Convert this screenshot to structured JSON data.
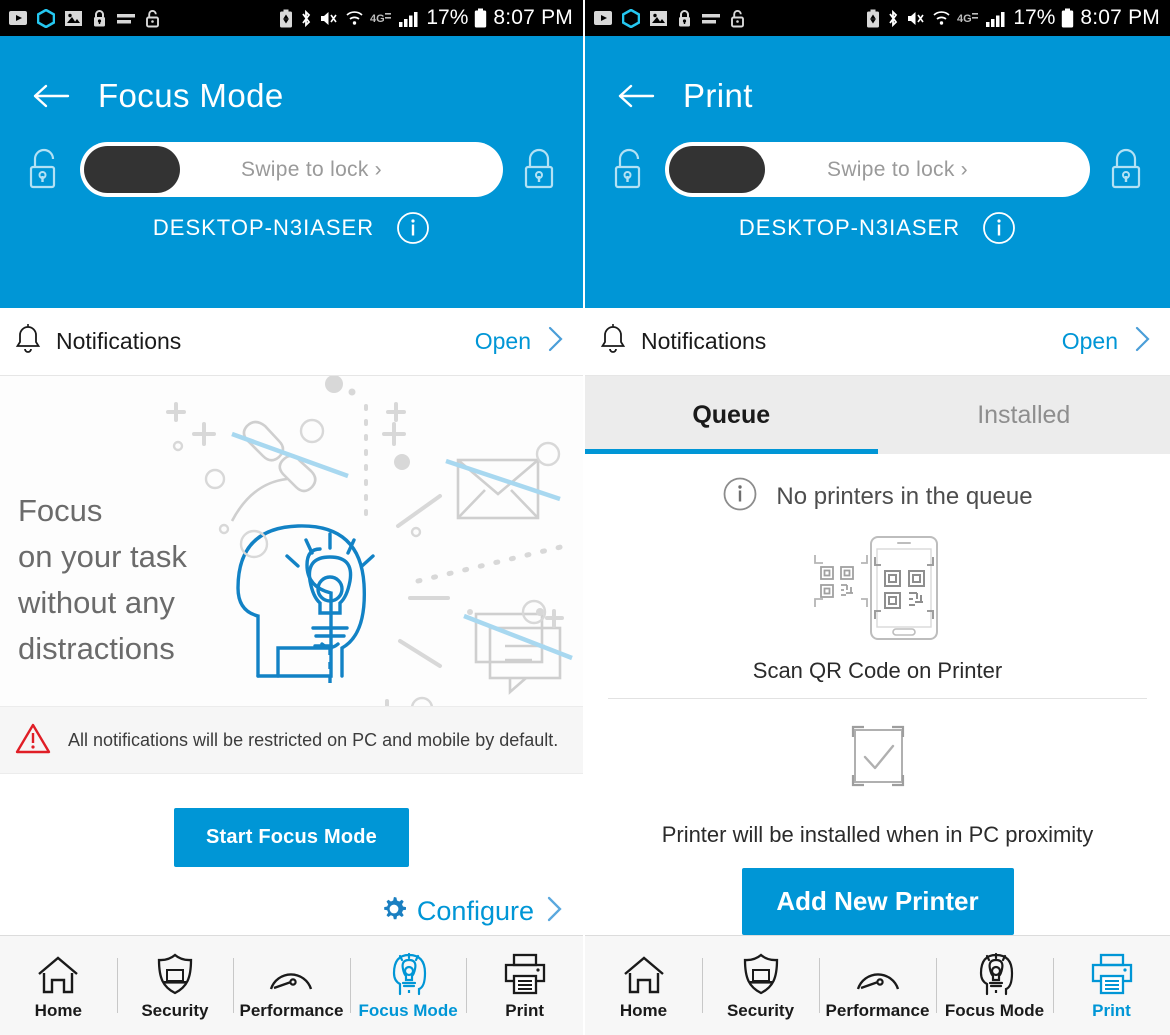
{
  "statusbar": {
    "left_icons": [
      "play-video-icon",
      "hexagon-icon",
      "image-icon",
      "lock-message-icon",
      "messages-icon",
      "unlocked-padlock-icon"
    ],
    "right_icons": [
      "battery-saver-icon",
      "bluetooth-icon",
      "mute-vibrate-icon",
      "wifi-icon",
      "4g-icon",
      "signal-bars-icon"
    ],
    "battery_percent": "17%",
    "time": "8:07 PM",
    "network": "4G"
  },
  "screens": [
    {
      "id": "focus-mode",
      "header": {
        "title": "Focus Mode",
        "back_icon": "back-arrow-icon",
        "left_lock_icon": "unlocked-padlock-icon",
        "right_lock_icon": "locked-padlock-icon",
        "swipe_label": "Swipe to lock",
        "swipe_chevron": "›",
        "device_name": "DESKTOP-N3IASER",
        "info_icon": "info-icon"
      },
      "notifications": {
        "bell_icon": "bell-icon",
        "label": "Notifications",
        "open_label": "Open",
        "chevron_icon": "chevron-right-icon"
      },
      "illustration": {
        "line1": "Focus",
        "line2": "on your task",
        "line3": "without any",
        "line4": "distractions",
        "icons": [
          "phone-handset-icon",
          "envelope-icon",
          "chat-bubbles-icon",
          "head-lightbulb-icon"
        ]
      },
      "warning": {
        "icon": "warning-triangle-icon",
        "color": "#e01e26",
        "text": "All notifications will be restricted on PC and mobile by default."
      },
      "start_button": "Start Focus Mode",
      "configure": {
        "icon": "gear-icon",
        "label": "Configure",
        "chevron_icon": "chevron-right-icon"
      }
    },
    {
      "id": "print",
      "header": {
        "title": "Print",
        "back_icon": "back-arrow-icon",
        "left_lock_icon": "unlocked-padlock-icon",
        "right_lock_icon": "locked-padlock-icon",
        "swipe_label": "Swipe to lock",
        "swipe_chevron": "›",
        "device_name": "DESKTOP-N3IASER",
        "info_icon": "info-icon"
      },
      "notifications": {
        "bell_icon": "bell-icon",
        "label": "Notifications",
        "open_label": "Open",
        "chevron_icon": "chevron-right-icon"
      },
      "tabs": [
        {
          "label": "Queue",
          "active": true
        },
        {
          "label": "Installed",
          "active": false
        }
      ],
      "empty_state": {
        "icon": "info-icon",
        "text": "No printers in the queue"
      },
      "scan": {
        "icon": "qr-scan-phone-icon",
        "label": "Scan QR Code on Printer"
      },
      "proximity": {
        "icon": "checkmark-scan-icon",
        "label": "Printer will be installed when in PC proximity"
      },
      "add_button": "Add New Printer"
    }
  ],
  "bottomnav": {
    "items": [
      {
        "label": "Home",
        "icon": "home-icon"
      },
      {
        "label": "Security",
        "icon": "shield-laptop-icon"
      },
      {
        "label": "Performance",
        "icon": "gauge-icon"
      },
      {
        "label": "Focus Mode",
        "icon": "head-lightbulb-icon"
      },
      {
        "label": "Print",
        "icon": "printer-icon"
      }
    ],
    "active_left": "Focus Mode",
    "active_right": "Print"
  },
  "colors": {
    "brand_blue": "#0096d6",
    "warning_red": "#e01e26",
    "status_bg": "#000000",
    "nav_bg": "#f7f7f7"
  }
}
